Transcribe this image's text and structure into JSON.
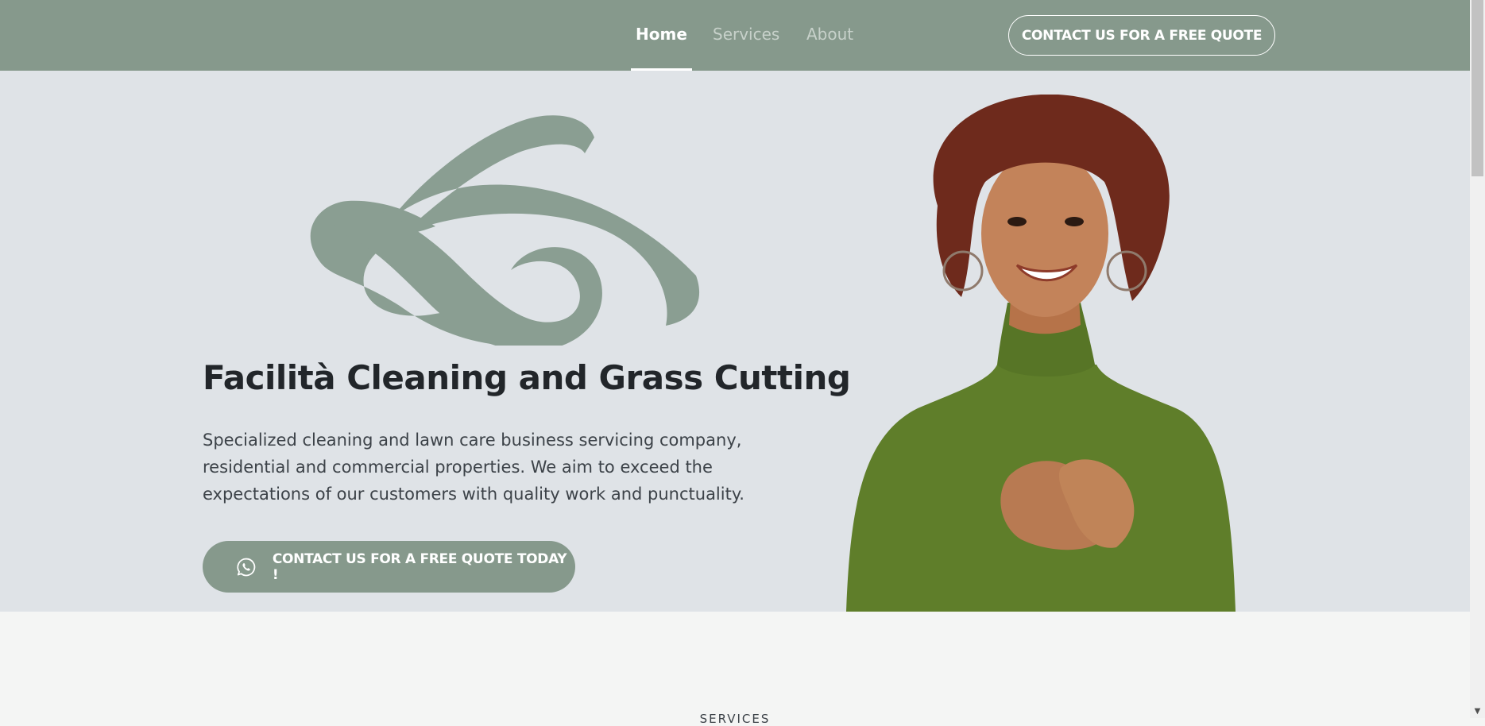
{
  "nav": {
    "items": [
      {
        "label": "Home",
        "active": true
      },
      {
        "label": "Services",
        "active": false
      },
      {
        "label": "About",
        "active": false
      }
    ],
    "cta_label": "CONTACT US FOR A FREE QUOTE"
  },
  "hero": {
    "title": "Facilità Cleaning and Grass Cutting",
    "description": "Specialized cleaning and lawn care business servicing company, residential and commercial properties. We aim to exceed the expectations of our customers with quality work and punctuality.",
    "cta_label": "CONTACT US FOR A FREE QUOTE TODAY !",
    "cta_icon": "whatsapp-icon"
  },
  "next_section": {
    "heading": "SERVICES"
  },
  "colors": {
    "header_bg": "#86998c",
    "hero_bg": "#dfe3e7",
    "accent": "#86998c",
    "title_text": "#22262a"
  }
}
